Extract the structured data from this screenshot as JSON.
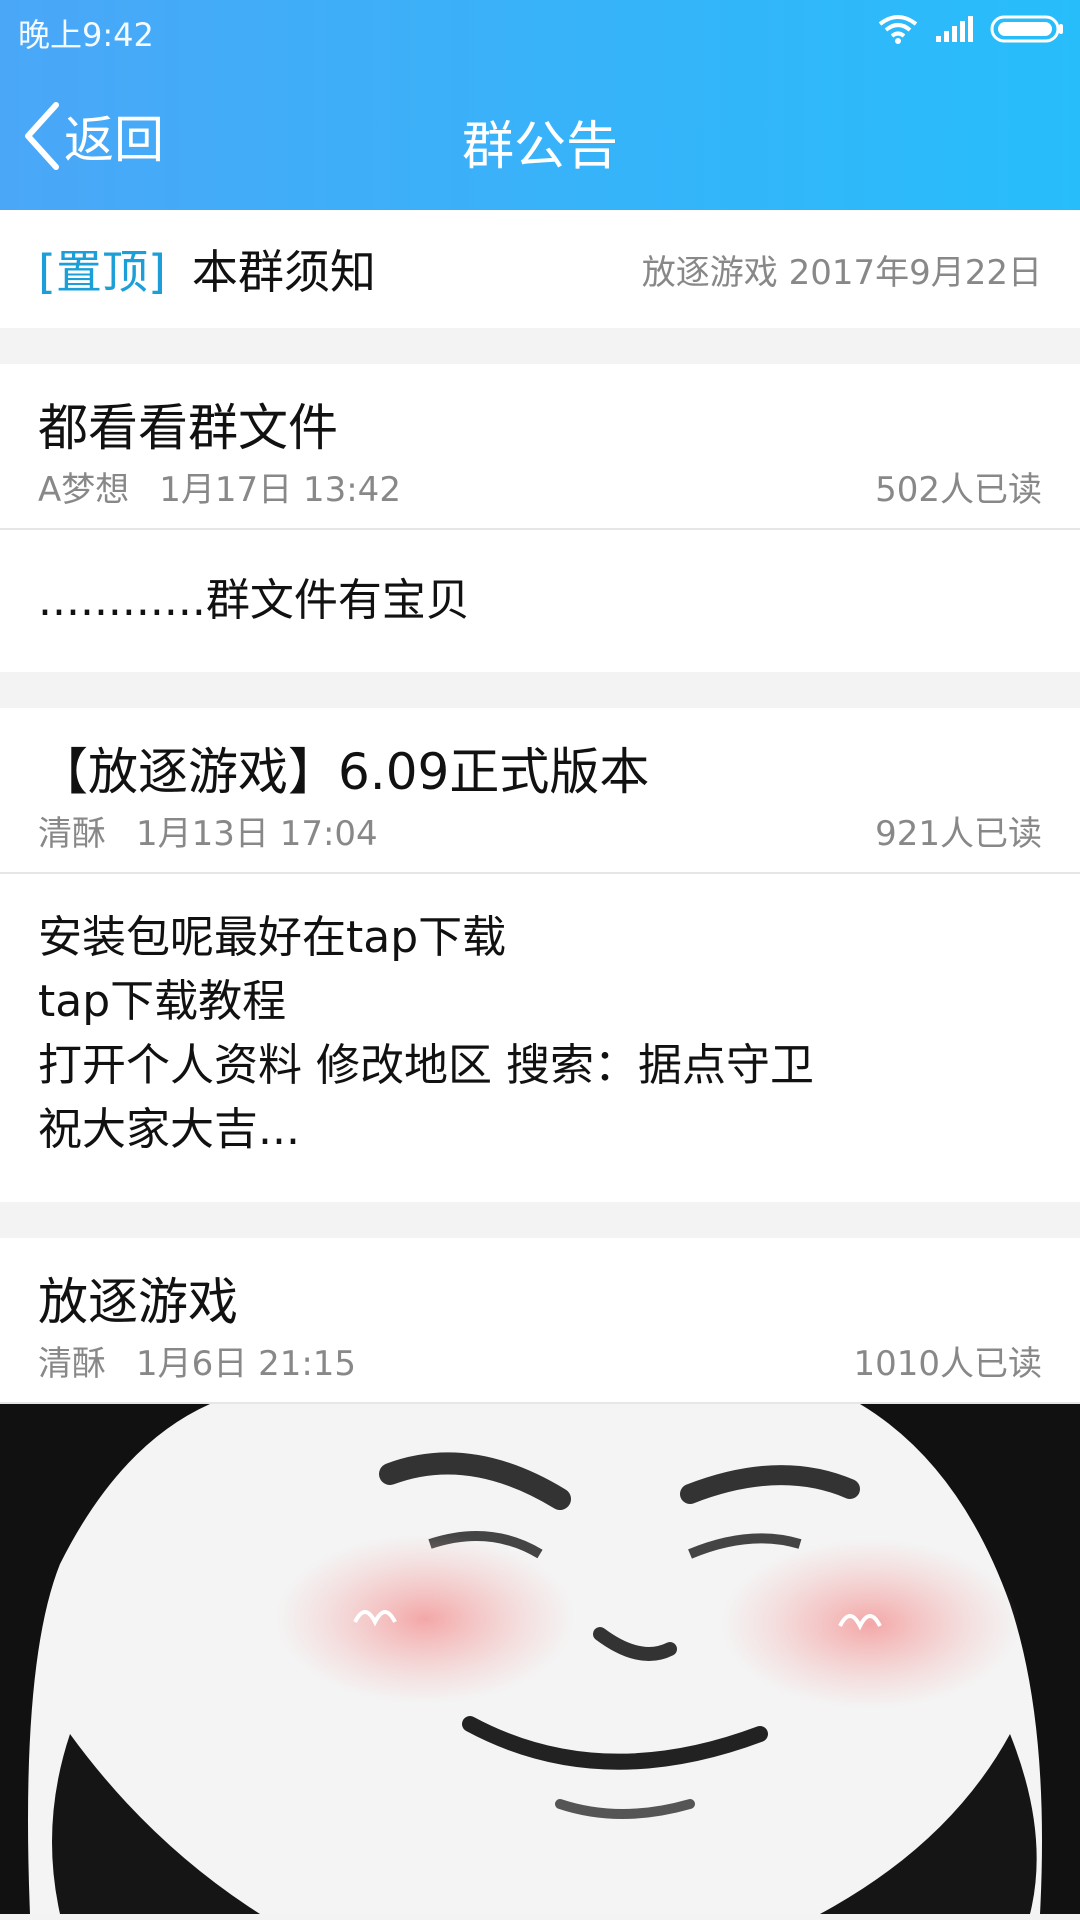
{
  "status_bar": {
    "time": "晚上9:42"
  },
  "nav": {
    "back_label": "返回",
    "title": "群公告"
  },
  "pinned": {
    "tag": "[置顶]",
    "title": "本群须知",
    "meta": "放逐游戏 2017年9月22日"
  },
  "announcements": [
    {
      "title": "都看看群文件",
      "author": "A梦想",
      "time": "1月17日 13:42",
      "reads": "502人已读",
      "body": [
        "............群文件有宝贝"
      ]
    },
    {
      "title": "【放逐游戏】6.09正式版本",
      "author": "清酥",
      "time": "1月13日 17:04",
      "reads": "921人已读",
      "body": [
        "安装包呢最好在tap下载",
        "tap下载教程",
        "打开个人资料 修改地区 搜索：据点守卫",
        "祝大家大吉..."
      ]
    },
    {
      "title": "放逐游戏",
      "author": "清酥",
      "time": "1月6日 21:15",
      "reads": "1010人已读",
      "image": "panda-meme-image"
    }
  ],
  "colors": {
    "header_start": "#4aa7f7",
    "header_end": "#27bdfb",
    "pinned_tag": "#1c9fd8",
    "meta": "#888888"
  }
}
